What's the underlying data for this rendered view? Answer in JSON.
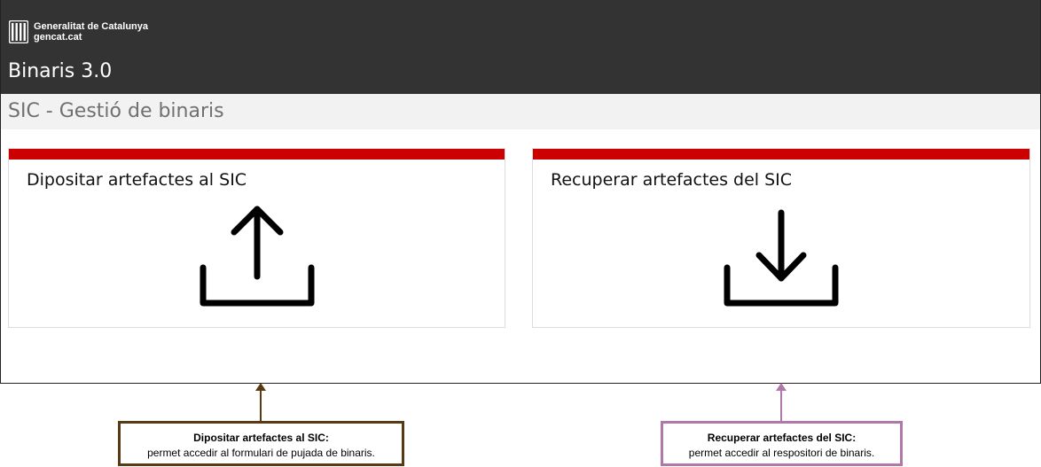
{
  "header": {
    "org_name": "Generalitat de Catalunya",
    "org_site": "gencat.cat",
    "app_title": "Binaris 3.0",
    "logo_icon": "generalitat-logo-icon"
  },
  "subheader": {
    "title": "SIC - Gestió de binaris"
  },
  "cards": [
    {
      "title": "Dipositar artefactes al SIC",
      "icon": "upload-icon",
      "accent": "#cc0000"
    },
    {
      "title": "Recuperar artefactes del SIC",
      "icon": "download-icon",
      "accent": "#cc0000"
    }
  ],
  "callouts": [
    {
      "title": "Dipositar artefactes al SIC:",
      "description": "permet accedir al formulari de pujada de binaris.",
      "color": "#5a3a12"
    },
    {
      "title": "Recuperar artefactes del SIC:",
      "description": "permet accedir al respositori de binaris.",
      "color": "#b077a8"
    }
  ],
  "colors": {
    "topbar": "#333333",
    "subbar": "#f2f2f2",
    "accent": "#cc0000"
  }
}
